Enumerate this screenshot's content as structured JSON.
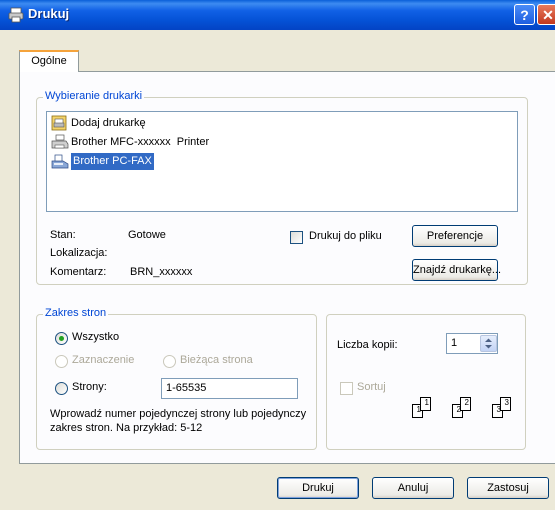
{
  "window": {
    "title": "Drukuj",
    "help_label": "?",
    "close_label": "✕"
  },
  "tabs": [
    {
      "label": "Ogólne"
    }
  ],
  "printer_group": {
    "label": "Wybieranie drukarki",
    "printers": [
      {
        "label": "Dodaj drukarkę",
        "icon": "add-printer-icon"
      },
      {
        "label": "Brother MFC-xxxxxx  Printer",
        "icon": "printer-icon"
      },
      {
        "label": "Brother PC-FAX",
        "icon": "fax-icon",
        "selected": true
      }
    ],
    "status_label": "Stan:",
    "status_value": "Gotowe",
    "location_label": "Lokalizacja:",
    "comment_label": "Komentarz:",
    "comment_value": "BRN_xxxxxx",
    "print_to_file_label": "Drukuj do pliku",
    "preferences_label": "Preferencje",
    "find_printer_label": "Znajdź drukarkę..."
  },
  "range_group": {
    "label": "Zakres stron",
    "all_label": "Wszystko",
    "selection_label": "Zaznaczenie",
    "current_page_label": "Bieżąca strona",
    "pages_label": "Strony:",
    "pages_value": "1-65535",
    "hint": "Wprowadź numer pojedynczej strony lub pojedynczy zakres stron. Na przykład: 5-12"
  },
  "copies_group": {
    "copies_label": "Liczba kopii:",
    "copies_value": "1",
    "collate_label": "Sortuj",
    "collate_pages": [
      "1",
      "1",
      "2",
      "2",
      "3",
      "3"
    ]
  },
  "footer": {
    "print_label": "Drukuj",
    "cancel_label": "Anuluj",
    "apply_label": "Zastosuj"
  }
}
